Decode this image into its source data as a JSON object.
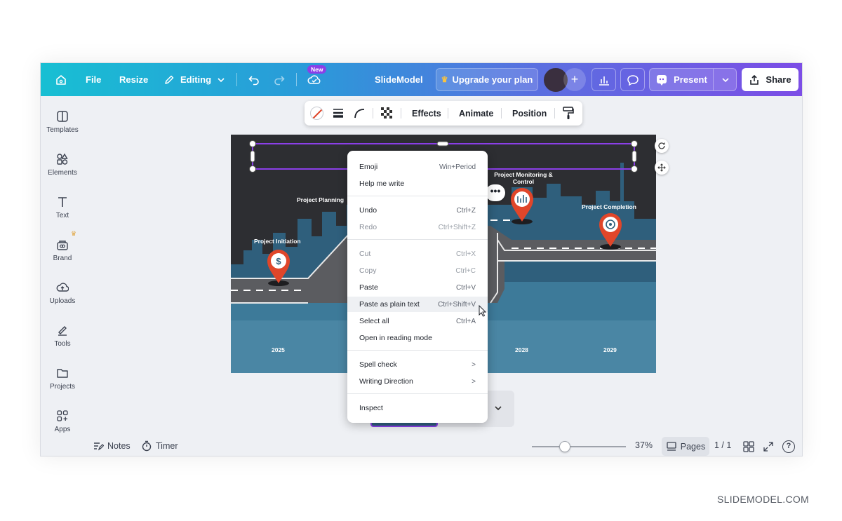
{
  "topbar": {
    "file": "File",
    "resize": "Resize",
    "editing": "Editing",
    "new_badge": "New",
    "title": "SlideModel",
    "upgrade": "Upgrade your plan",
    "present": "Present",
    "share": "Share"
  },
  "sidebar": {
    "items": [
      {
        "label": "Templates",
        "icon": "templates-icon"
      },
      {
        "label": "Elements",
        "icon": "elements-icon"
      },
      {
        "label": "Text",
        "icon": "text-icon"
      },
      {
        "label": "Brand",
        "icon": "brand-icon"
      },
      {
        "label": "Uploads",
        "icon": "uploads-icon"
      },
      {
        "label": "Tools",
        "icon": "tools-icon"
      },
      {
        "label": "Projects",
        "icon": "projects-icon"
      },
      {
        "label": "Apps",
        "icon": "apps-icon"
      }
    ]
  },
  "ctx_toolbar": {
    "effects": "Effects",
    "animate": "Animate",
    "position": "Position"
  },
  "slide": {
    "milestones": [
      "Project Initiation",
      "Project Planning",
      "Project Monitoring & Control",
      "Project Completion"
    ],
    "years": [
      "2025",
      "2028",
      "2029"
    ]
  },
  "menu": {
    "items": [
      {
        "label": "Emoji",
        "shortcut": "Win+Period"
      },
      {
        "label": "Help me write",
        "shortcut": ""
      },
      {
        "label": "Undo",
        "shortcut": "Ctrl+Z"
      },
      {
        "label": "Redo",
        "shortcut": "Ctrl+Shift+Z"
      },
      {
        "label": "Cut",
        "shortcut": "Ctrl+X"
      },
      {
        "label": "Copy",
        "shortcut": "Ctrl+C"
      },
      {
        "label": "Paste",
        "shortcut": "Ctrl+V"
      },
      {
        "label": "Paste as plain text",
        "shortcut": "Ctrl+Shift+V"
      },
      {
        "label": "Select all",
        "shortcut": "Ctrl+A"
      },
      {
        "label": "Open in reading mode",
        "shortcut": ""
      },
      {
        "label": "Spell check",
        "shortcut": ">"
      },
      {
        "label": "Writing Direction",
        "shortcut": ">"
      },
      {
        "label": "Inspect",
        "shortcut": ""
      }
    ]
  },
  "bottombar": {
    "notes": "Notes",
    "timer": "Timer",
    "zoom": "37%",
    "pages": "Pages",
    "page_count": "1 / 1"
  },
  "watermark": "SLIDEMODEL.COM",
  "colors": {
    "accent": "#7c4de6",
    "pin": "#e0462a",
    "road": "#5b5c60",
    "water": "#3d7a99"
  }
}
